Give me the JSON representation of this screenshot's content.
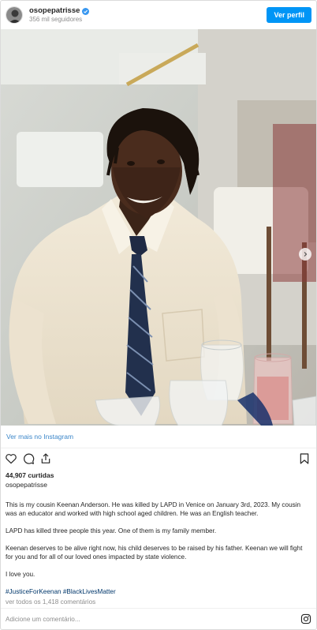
{
  "header": {
    "username": "osopepatrisse",
    "followers": "356 mil seguidores",
    "follow_label": "Ver perfil"
  },
  "view_more": "Ver mais no Instagram",
  "likes": "44,907 curtidas",
  "poster": "osopepatrisse",
  "caption": {
    "p1": "This is my cousin Keenan Anderson. He was killed by LAPD in Venice on January 3rd, 2023. My cousin was an educator and worked with high school aged children. He was an English teacher.",
    "p2": "LAPD has killed three people this year. One of them is my family member.",
    "p3": "Keenan deserves to be alive right now, his child deserves to be raised by his father. Keenan we will fight for you and for all of our loved ones impacted by state violence.",
    "p4": "I love you.",
    "hashtags": "#JusticeForKeenan #BlackLivesMatter"
  },
  "comments_link": "ver todos os 1,418 comentários",
  "comment_placeholder": "Adicione um comentário...",
  "colors": {
    "accent": "#0095f6",
    "link": "#00376b",
    "muted": "#8e8e8e"
  },
  "icons": [
    "verified-badge-icon",
    "chevron-right-icon",
    "heart-icon",
    "comment-icon",
    "share-icon",
    "bookmark-icon",
    "instagram-icon"
  ]
}
